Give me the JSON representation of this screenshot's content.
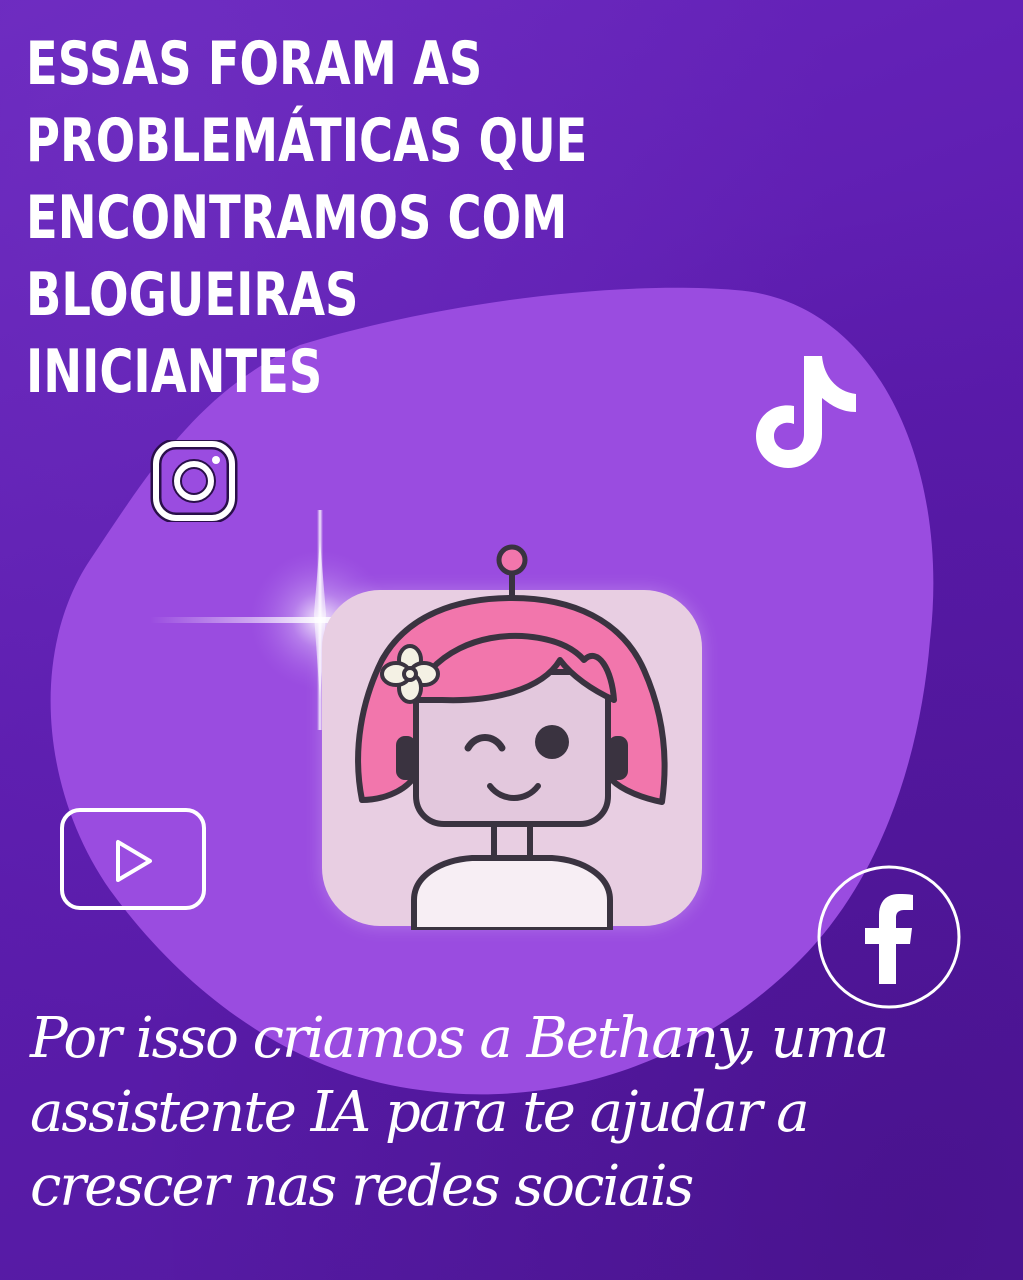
{
  "headline": {
    "line1": "ESSAS FORAM AS",
    "line2": "PROBLEMÁTICAS QUE",
    "line3": "ENCONTRAMOS COM BLOGUEIRAS",
    "line4": "INICIANTES"
  },
  "tagline": {
    "line1": "Por isso criamos a  Bethany, uma",
    "line2": "assistente IA para te ajudar a",
    "line3": "crescer nas redes sociais"
  },
  "icons": {
    "instagram": "instagram-icon",
    "tiktok": "tiktok-icon",
    "youtube": "youtube-icon",
    "facebook": "facebook-icon",
    "app": "robot-girl-icon"
  },
  "colors": {
    "background": "#5e1fae",
    "blob": "#9a4ce0",
    "app_card": "#e8cee2",
    "hair": "#f276ac",
    "text": "#ffffff"
  }
}
